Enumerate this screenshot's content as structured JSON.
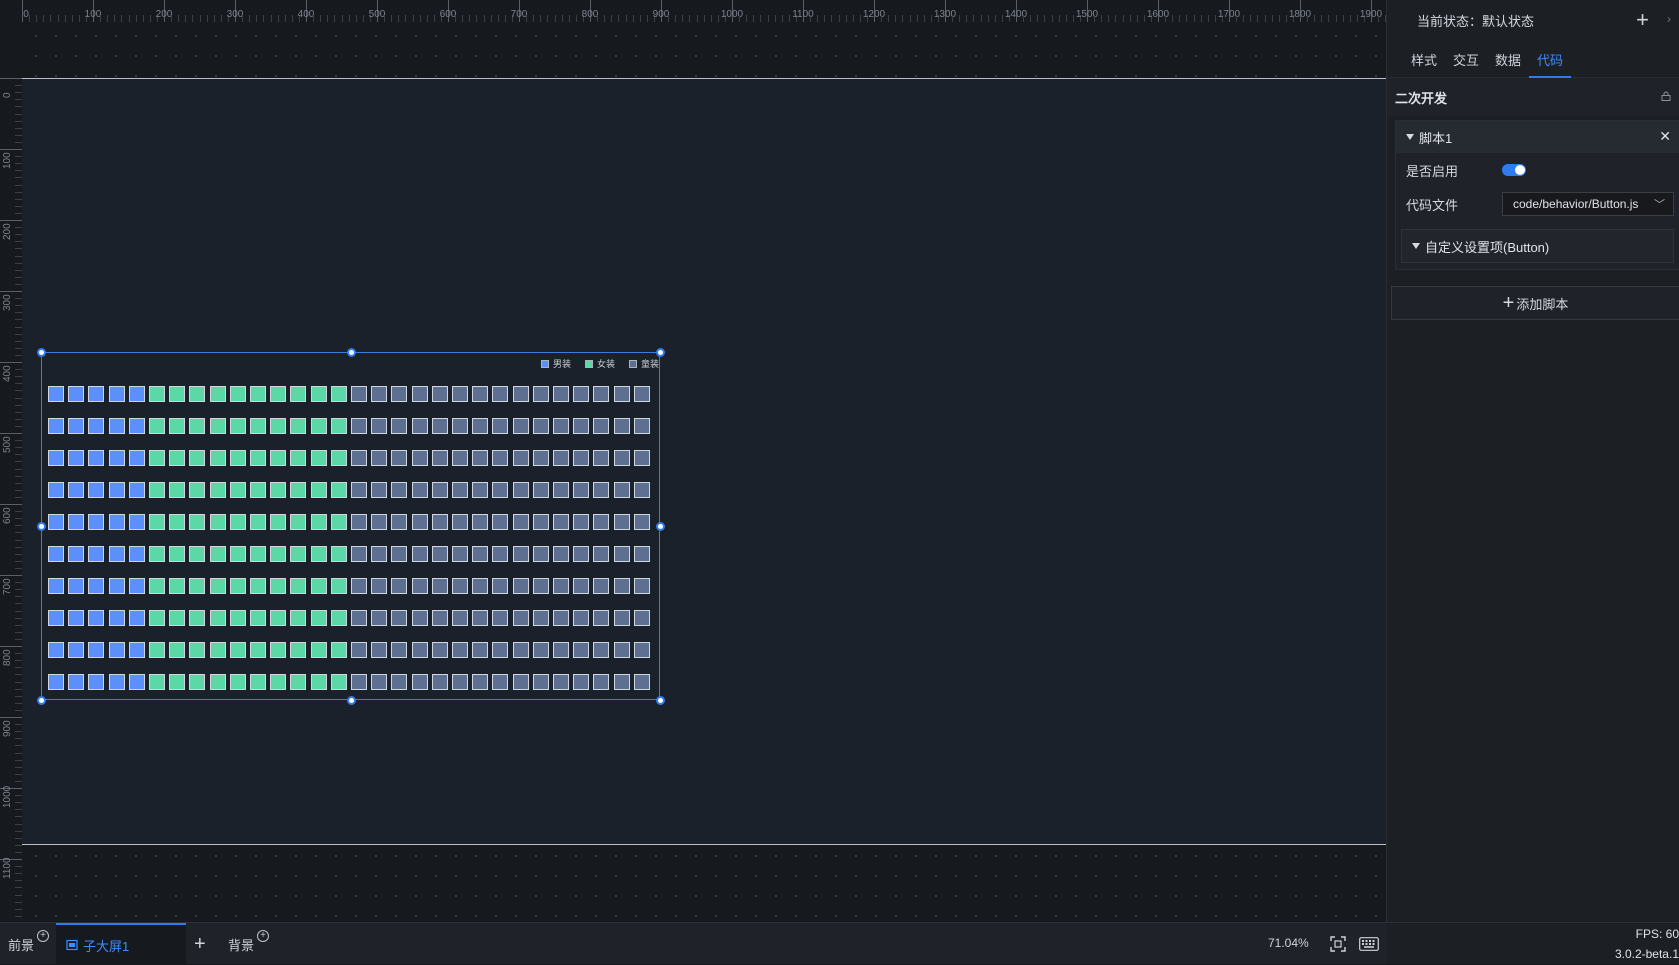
{
  "ruler": {
    "h_labels": [
      "0",
      "100",
      "200",
      "300",
      "400",
      "500",
      "600",
      "700",
      "800",
      "900",
      "1000",
      "1100",
      "1200",
      "1300",
      "1400",
      "1500",
      "1600",
      "1700",
      "1800",
      "1900"
    ],
    "v_labels": [
      "0",
      "100",
      "200",
      "300",
      "400",
      "500",
      "600",
      "700",
      "800",
      "900",
      "1000",
      "1100"
    ]
  },
  "component": {
    "legend": [
      {
        "label": "男装",
        "color": "#5b8ff9"
      },
      {
        "label": "女装",
        "color": "#5ad8a6"
      },
      {
        "label": "童装",
        "color": "#5d7092"
      }
    ],
    "rows": 10,
    "groups": [
      {
        "count": 5,
        "color": "#5b8ff9"
      },
      {
        "count": 10,
        "color": "#5ad8a6"
      },
      {
        "count": 15,
        "color": "#5d7092"
      }
    ]
  },
  "bottom_bar": {
    "foreground_label": "前景",
    "active_tab_label": "子大屏1",
    "add_label": "+",
    "background_label": "背景",
    "zoom": "71.04%"
  },
  "panel": {
    "state_label": "当前状态：默认状态",
    "tabs": [
      {
        "label": "样式",
        "active": false
      },
      {
        "label": "交互",
        "active": false
      },
      {
        "label": "数据",
        "active": false
      },
      {
        "label": "代码",
        "active": true
      }
    ],
    "section_title": "二次开发",
    "script": {
      "title": "脚本1",
      "enabled_label": "是否启用",
      "enabled": true,
      "file_label": "代码文件",
      "file_value": "code/behavior/Button.js",
      "custom_settings_label": "自定义设置项(Button)"
    },
    "add_script_label": "添加脚本"
  },
  "status": {
    "fps": "FPS: 60",
    "version": "3.0.2-beta.1"
  },
  "colors": {
    "accent": "#2f7cf0",
    "selection_border": "#3d7bd6"
  }
}
